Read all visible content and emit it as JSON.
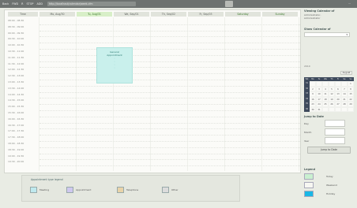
{
  "topbar": {
    "left_items": [
      "Back",
      "FWD",
      "R",
      "STOP",
      "ADD"
    ],
    "url_bar": "http://localhost/calendar/week.cfm",
    "right_text": "..."
  },
  "calendar": {
    "time_header": "Time",
    "columns": [
      {
        "label": "Mo, Aug/30",
        "today": false,
        "weekend": false
      },
      {
        "label": "Tu, Aug/31",
        "today": true,
        "weekend": false
      },
      {
        "label": "We, Sep/01",
        "today": false,
        "weekend": false
      },
      {
        "label": "Th, Sep/02",
        "today": false,
        "weekend": false
      },
      {
        "label": "Fr, Sep/03",
        "today": false,
        "weekend": false
      },
      {
        "label": "Saturday",
        "today": false,
        "weekend": true
      },
      {
        "label": "Sunday",
        "today": false,
        "weekend": true
      }
    ],
    "times": [
      "08:00 - 08:30",
      "08:30 - 09:00",
      "09:00 - 09:30",
      "09:30 - 10:00",
      "10:00 - 10:30",
      "10:30 - 11:00",
      "11:00 - 11:30",
      "11:30 - 12:00",
      "12:00 - 12:30",
      "12:30 - 13:00",
      "13:00 - 13:30",
      "13:30 - 14:00",
      "14:00 - 14:30",
      "14:30 - 15:00",
      "15:00 - 15:30",
      "15:30 - 16:00",
      "16:00 - 16:30",
      "16:30 - 17:00",
      "17:00 - 17:30",
      "17:30 - 18:00",
      "18:00 - 18:30",
      "18:30 - 19:00",
      "19:00 - 19:30",
      "19:30 - 20:00"
    ],
    "appointment": {
      "title": "General",
      "subtitle": "Appointment",
      "dots": [
        ":",
        ":",
        ":",
        ":"
      ]
    }
  },
  "appt_legend": {
    "title": "Appointment type legend",
    "items": [
      {
        "label": "Meeting",
        "color": "#bfe9ee"
      },
      {
        "label": "Appointment",
        "color": "#cfc8ef"
      },
      {
        "label": "Telephone",
        "color": "#e8d3a8"
      },
      {
        "label": "Other",
        "color": "#dcdcdc"
      }
    ]
  },
  "sidebar": {
    "viewing_title": "Viewing Calendar of",
    "viewing_sub": [
      "Administrator,",
      "Administrator"
    ],
    "show_title": "Show Calendar of",
    "show_select": "",
    "mini_label": "2010",
    "mini_month": "August",
    "weekday_heads": [
      "Wk",
      "Mo",
      "Tu",
      "We",
      "Th",
      "Fr",
      "Sa",
      "Su"
    ],
    "weeks": [
      {
        "wk": "31",
        "days": [
          "",
          "",
          "",
          "",
          "",
          "",
          "1"
        ]
      },
      {
        "wk": "32",
        "days": [
          "2",
          "3",
          "4",
          "5",
          "6",
          "7",
          "8"
        ]
      },
      {
        "wk": "33",
        "days": [
          "9",
          "10",
          "11",
          "12",
          "13",
          "14",
          "15"
        ]
      },
      {
        "wk": "34",
        "days": [
          "16",
          "17",
          "18",
          "19",
          "20",
          "21",
          "22"
        ]
      },
      {
        "wk": "35",
        "days": [
          "23",
          "24",
          "25",
          "26",
          "27",
          "28",
          "29"
        ]
      },
      {
        "wk": "36",
        "days": [
          "30",
          "31",
          "",
          "",
          "",
          "",
          ""
        ]
      }
    ],
    "jump_title": "Jump to Date",
    "jump_fields": [
      "Day",
      "Month",
      "Year"
    ],
    "jump_button": "Jump to Date",
    "legend_title": "Legend",
    "legend_items": [
      {
        "label": "Today",
        "color": "#c9f0d0"
      },
      {
        "label": "Weekend",
        "color": "#f7f7f2"
      },
      {
        "label": "Holiday",
        "color": "#19b7e6"
      }
    ]
  }
}
